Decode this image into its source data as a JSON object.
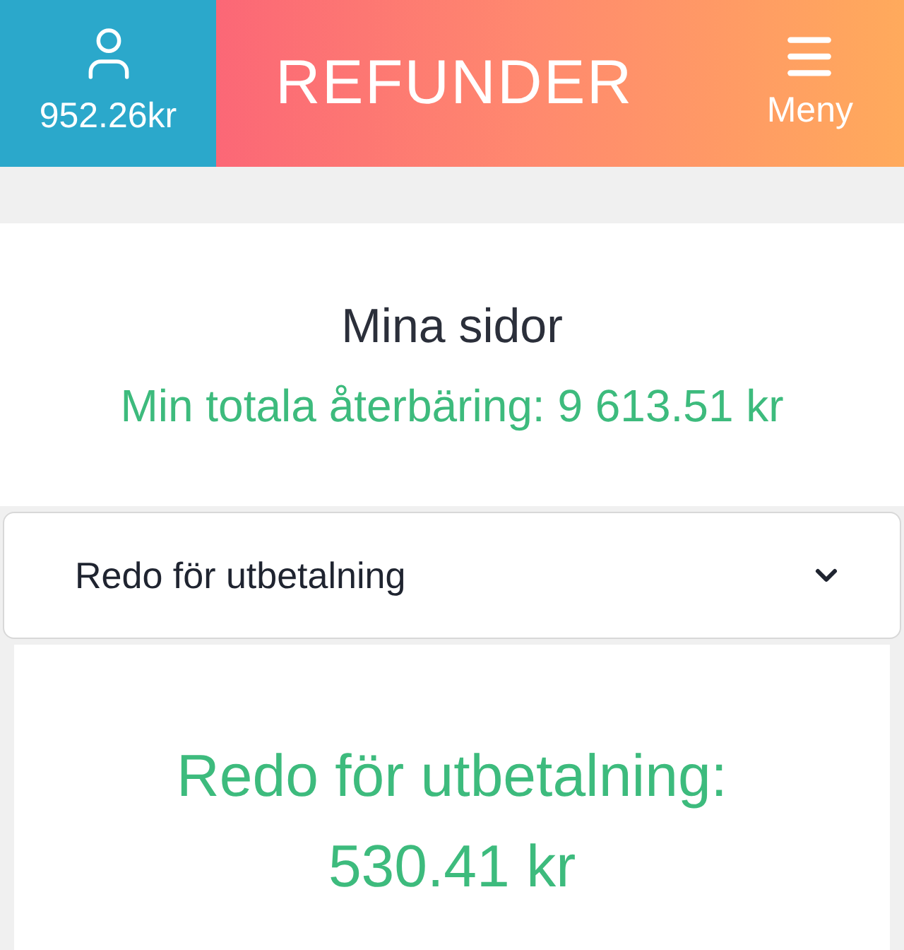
{
  "header": {
    "balance": "952.26kr",
    "logo": "REFUNDER",
    "menu_label": "Meny"
  },
  "profile": {
    "title": "Mina sidor",
    "total": "Min totala återbäring: 9 613.51 kr"
  },
  "filter": {
    "value": "Redo för utbetalning"
  },
  "card": {
    "lines": [
      "Redo för utbetalning:",
      "530.41 kr"
    ]
  }
}
